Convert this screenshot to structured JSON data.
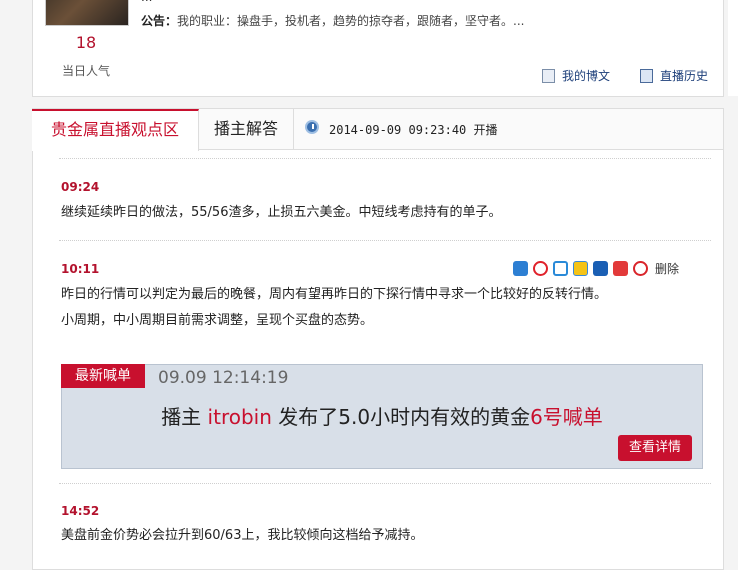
{
  "profile": {
    "top_text": "...",
    "popularity_value": "18",
    "popularity_label": "当日人气",
    "notice_label": "公告：",
    "notice_text": "我的职业：操盘手，投机者，趋势的掠夺者，跟随者，坚守者。...",
    "my_blog_link": "我的博文",
    "history_link": "直播历史"
  },
  "tabs": {
    "active": "贵金属直播观点区",
    "second": "播主解答",
    "start_time": "2014-09-09 09:23:40 开播"
  },
  "entries": [
    {
      "time": "09:24",
      "lines": [
        "继续延续昨日的做法，55/56渣多，止损五六美金。中短线考虑持有的单子。"
      ]
    },
    {
      "time": "10:11",
      "lines": [
        "昨日的行情可以判定为最后的晚餐，周内有望再昨日的下探行情中寻求一个比较好的反转行情。",
        "小周期，中小周期目前需求调整，呈现个买盘的态势。"
      ]
    },
    {
      "time": "14:52",
      "lines": [
        "美盘前金价势必会拉升到60/63上，我比较倾向这档给予减持。"
      ]
    }
  ],
  "share": {
    "icons": [
      "baidu-icon",
      "weibo-icon",
      "qq-space-icon",
      "qzone-star-icon",
      "renren-icon",
      "tencent-weibo-icon",
      "delete-icon"
    ],
    "delete_label": "删除"
  },
  "shout_card": {
    "tag": "最新喊单",
    "time": "09.09 12:14:19",
    "msg_prefix": "播主 ",
    "msg_user": "itrobin",
    "msg_middle": " 发布了5.0小时内有效的黄金",
    "msg_highlight": "6号喊单",
    "button": "查看详情"
  },
  "colors": {
    "accent": "#c8102e",
    "link": "#1d3f7a",
    "card_bg": "#d8dfe8"
  }
}
